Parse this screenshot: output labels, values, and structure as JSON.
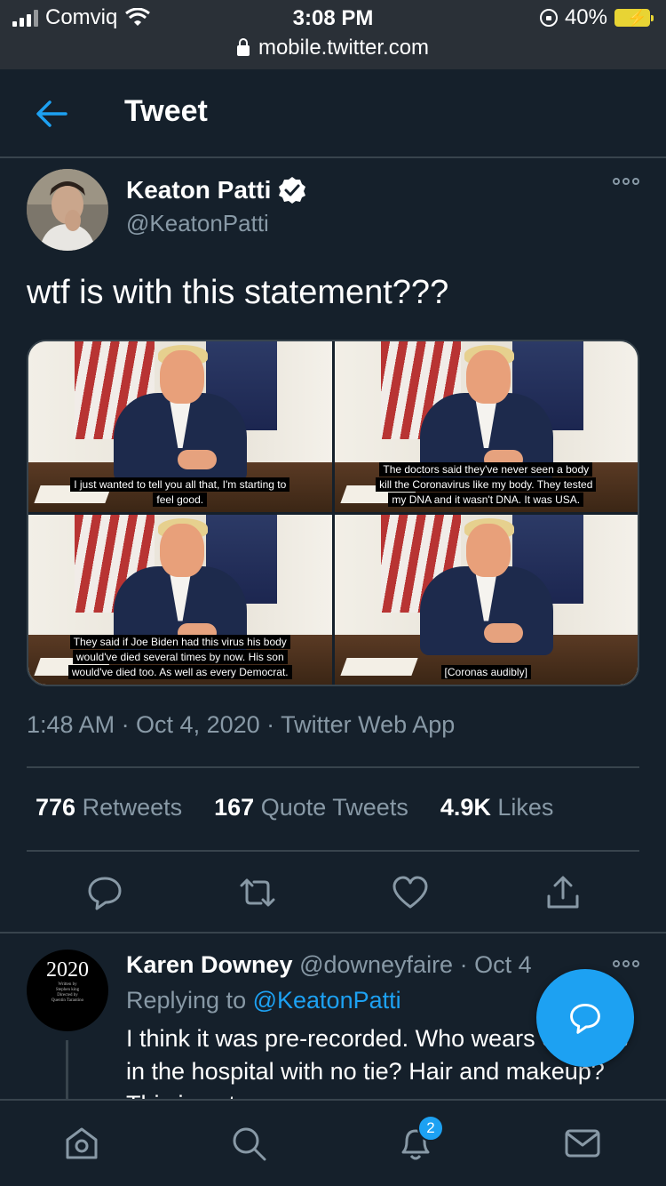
{
  "status_bar": {
    "carrier": "Comviq",
    "time": "3:08 PM",
    "battery": "40%",
    "url": "mobile.twitter.com"
  },
  "header": {
    "title": "Tweet"
  },
  "tweet": {
    "author_name": "Keaton Patti",
    "author_handle": "@KeatonPatti",
    "text": "wtf is with this statement???",
    "captions": [
      [
        "I just wanted to tell you all that, I'm starting to",
        "feel good."
      ],
      [
        "The doctors said they've never seen a body",
        "kill the Coronavirus like my body. They tested",
        "my DNA and it wasn't DNA. It was USA."
      ],
      [
        "They said if Joe Biden had this virus his body",
        "would've died several times by now. His son",
        "would've died too. As well as every Democrat."
      ],
      [
        "[Coronas audibly]"
      ]
    ],
    "timestamp": "1:48 AM · Oct 4, 2020 · Twitter Web App",
    "retweets_count": "776",
    "retweets_label": "Retweets",
    "quote_count": "167",
    "quote_label": "Quote Tweets",
    "likes_count": "4.9K",
    "likes_label": "Likes"
  },
  "reply": {
    "avatar_text": "2020",
    "avatar_small_1": "Written by",
    "avatar_small_2": "Stephen king",
    "avatar_small_3": "Directed by",
    "avatar_small_4": "Quentin Tarantino",
    "author_name": "Karen Downey",
    "author_meta": "@downeyfaire · Oct 4",
    "replying_prefix": "Replying to",
    "replying_to": "@KeatonPatti",
    "text": "I think it was pre-recorded. Who wears cufflinks in the hospital with no tie? Hair and makeup? This is not"
  },
  "nav": {
    "notifications_badge": "2"
  },
  "colors": {
    "background": "#15202b",
    "accent": "#1da1f2",
    "muted": "#8899a6",
    "border": "#38444d"
  }
}
